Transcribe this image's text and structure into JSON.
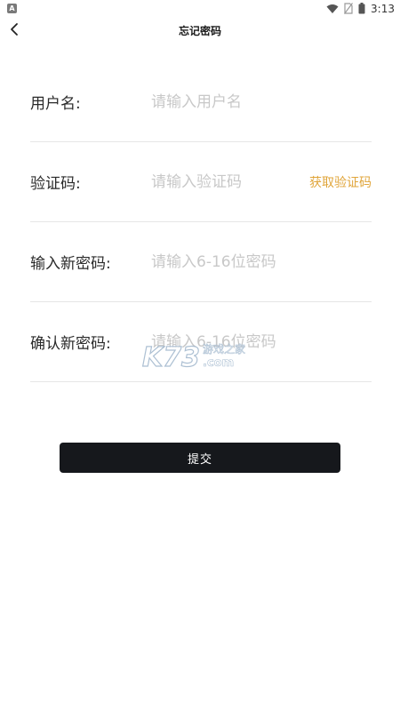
{
  "status_bar": {
    "app_icon_letter": "A",
    "time": "3:13"
  },
  "header": {
    "title": "忘记密码",
    "back_icon": "chevron-left-icon"
  },
  "form": {
    "username": {
      "label": "用户名:",
      "placeholder": "请输入用户名",
      "value": ""
    },
    "code": {
      "label": "验证码:",
      "placeholder": "请输入验证码",
      "value": "",
      "get_code_label": "获取验证码"
    },
    "new_password": {
      "label": "输入新密码:",
      "placeholder": "请输入6-16位密码",
      "value": ""
    },
    "confirm_password": {
      "label": "确认新密码:",
      "placeholder": "请输入6-16位密码",
      "value": ""
    }
  },
  "submit": {
    "label": "提交"
  },
  "watermark": {
    "logo_text": "K73",
    "site_text": "游戏之家",
    "domain_text": ".com"
  },
  "colors": {
    "accent": "#e0a53a",
    "button_bg": "#16181c",
    "divider": "#e6e6e6",
    "placeholder": "#c8c8c8"
  }
}
